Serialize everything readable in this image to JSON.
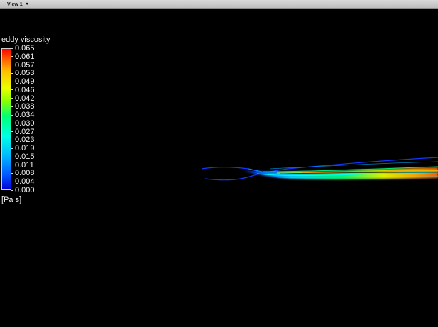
{
  "toolbar": {
    "view_label": "View 1",
    "view_caret": "▾"
  },
  "legend": {
    "title": "eddy viscosity",
    "values": [
      "0.065",
      "0.061",
      "0.057",
      "0.053",
      "0.049",
      "0.046",
      "0.042",
      "0.038",
      "0.034",
      "0.030",
      "0.027",
      "0.023",
      "0.019",
      "0.015",
      "0.011",
      "0.008",
      "0.004",
      "0.000"
    ],
    "unit": "[Pa s]"
  },
  "colors": {
    "background": "#000000",
    "tabbar": "#c8c8c8",
    "legend_text": "#f2f2f2",
    "low": "#0000d8",
    "mid": "#00ff75",
    "high": "#ff0000"
  }
}
